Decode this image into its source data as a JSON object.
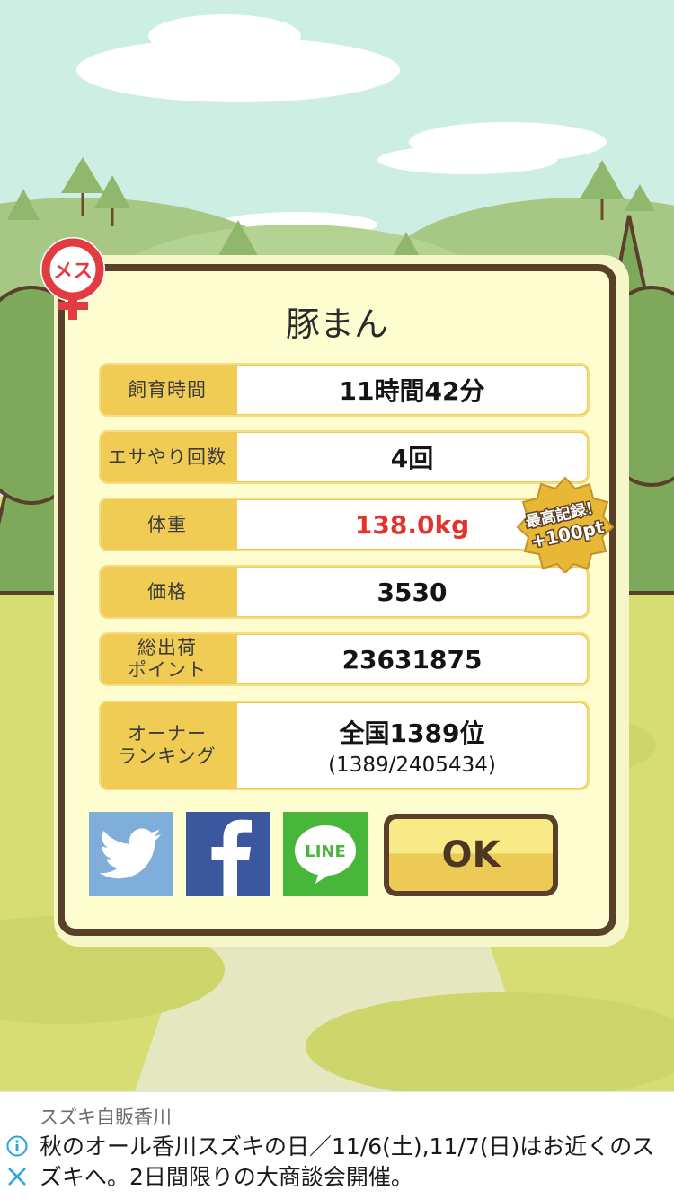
{
  "pig": {
    "name": "豚まん",
    "gender_badge": "メス"
  },
  "stats": [
    {
      "label": "飼育時間",
      "value": "11時間42分"
    },
    {
      "label": "エサやり回数",
      "value": "4回"
    },
    {
      "label": "体重",
      "value": "138.0kg"
    },
    {
      "label": "価格",
      "value": "3530"
    },
    {
      "label": "総出荷\nポイント",
      "value": "23631875"
    },
    {
      "label": "オーナー\nランキング",
      "value": "全国1389位",
      "sub": "(1389/2405434)"
    }
  ],
  "record_badge": {
    "line1": "最高記録！",
    "line2": "+100pt"
  },
  "buttons": {
    "line_label": "LINE",
    "ok_label": "OK"
  },
  "ad": {
    "sponsor": "スズキ自販香川",
    "text": "秋のオール香川スズキの日／11/6(土),11/7(日)はお近くのスズキへ。2日間限りの大商談会開催。"
  },
  "colors": {
    "panel_border": "#5a3f2a",
    "label_bg": "#f1cc55",
    "weight_red": "#e0342c",
    "twitter": "#80aedb",
    "facebook": "#3b579d",
    "line": "#48b63a"
  }
}
